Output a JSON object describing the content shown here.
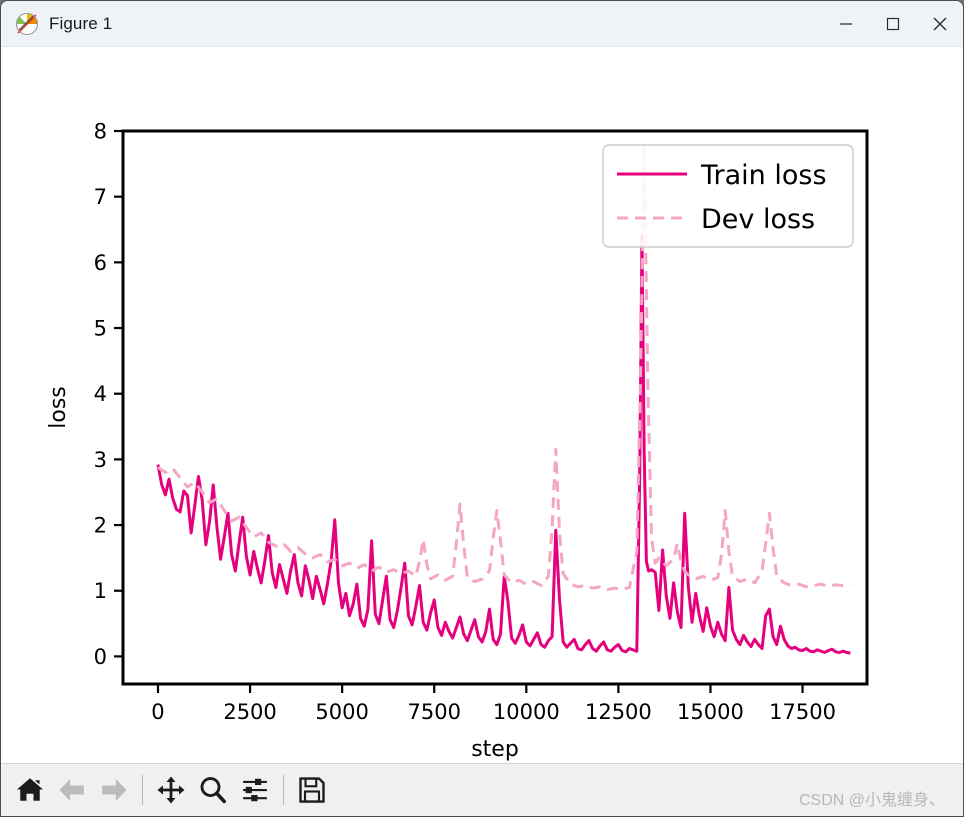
{
  "window": {
    "title": "Figure 1",
    "icon": "matplotlib-icon",
    "minimize_label": "–",
    "maximize_label": "□",
    "close_label": "✕"
  },
  "toolbar": {
    "items": [
      {
        "name": "home-button",
        "icon": "home-icon",
        "enabled": true
      },
      {
        "name": "back-button",
        "icon": "arrow-left-icon",
        "enabled": false
      },
      {
        "name": "forward-button",
        "icon": "arrow-right-icon",
        "enabled": false
      },
      {
        "name": "pan-button",
        "icon": "move-icon",
        "enabled": true
      },
      {
        "name": "zoom-button",
        "icon": "magnifier-icon",
        "enabled": true
      },
      {
        "name": "configure-subplots-button",
        "icon": "sliders-icon",
        "enabled": true
      },
      {
        "name": "save-button",
        "icon": "floppy-disk-icon",
        "enabled": true
      }
    ],
    "watermark": "CSDN @小鬼缠身、"
  },
  "chart_data": {
    "type": "line",
    "title": "",
    "xlabel": "step",
    "ylabel": "loss",
    "xlim": [
      -950,
      19250
    ],
    "ylim": [
      -0.42,
      8.0
    ],
    "xticks": [
      0,
      2500,
      5000,
      7500,
      10000,
      12500,
      15000,
      17500
    ],
    "xtick_labels": [
      "0",
      "2500",
      "5000",
      "7500",
      "10000",
      "12500",
      "15000",
      "17500"
    ],
    "yticks": [
      0,
      1,
      2,
      3,
      4,
      5,
      6,
      7,
      8
    ],
    "ytick_labels": [
      "0",
      "1",
      "2",
      "3",
      "4",
      "5",
      "6",
      "7",
      "8"
    ],
    "grid": false,
    "legend": {
      "position": "upper right",
      "frame": true
    },
    "colors": {
      "train": "#E5007E",
      "dev": "#F4A6C4",
      "axis": "#000000"
    },
    "series": [
      {
        "name": "Train loss",
        "label": "Train loss",
        "color": "#E5007E",
        "style": "solid",
        "width": 3.0,
        "x": [
          0,
          100,
          200,
          300,
          400,
          500,
          600,
          700,
          800,
          900,
          1000,
          1100,
          1200,
          1300,
          1400,
          1500,
          1600,
          1700,
          1800,
          1900,
          2000,
          2100,
          2200,
          2300,
          2400,
          2500,
          2600,
          2700,
          2800,
          2900,
          3000,
          3100,
          3200,
          3300,
          3400,
          3500,
          3600,
          3700,
          3800,
          3900,
          4000,
          4100,
          4200,
          4300,
          4400,
          4500,
          4600,
          4700,
          4800,
          4900,
          5000,
          5100,
          5200,
          5300,
          5400,
          5500,
          5600,
          5700,
          5800,
          5900,
          6000,
          6100,
          6200,
          6300,
          6400,
          6500,
          6600,
          6700,
          6800,
          6900,
          7000,
          7100,
          7200,
          7300,
          7400,
          7500,
          7600,
          7700,
          7800,
          7900,
          8000,
          8100,
          8200,
          8300,
          8400,
          8500,
          8600,
          8700,
          8800,
          8900,
          9000,
          9100,
          9200,
          9300,
          9400,
          9500,
          9600,
          9700,
          9800,
          9900,
          10000,
          10100,
          10200,
          10300,
          10400,
          10500,
          10600,
          10700,
          10800,
          10900,
          11000,
          11100,
          11200,
          11300,
          11400,
          11500,
          11600,
          11700,
          11800,
          11900,
          12000,
          12100,
          12200,
          12300,
          12400,
          12500,
          12600,
          12700,
          12800,
          12900,
          13000,
          13080,
          13140,
          13200,
          13260,
          13320,
          13400,
          13500,
          13600,
          13700,
          13800,
          13900,
          14000,
          14100,
          14200,
          14300,
          14400,
          14500,
          14600,
          14700,
          14800,
          14900,
          15000,
          15100,
          15200,
          15300,
          15400,
          15500,
          15600,
          15700,
          15800,
          15900,
          16000,
          16100,
          16200,
          16300,
          16400,
          16500,
          16600,
          16700,
          16800,
          16900,
          17000,
          17100,
          17200,
          17300,
          17400,
          17500,
          17600,
          17700,
          17800,
          17900,
          18000,
          18100,
          18200,
          18300,
          18400,
          18500,
          18600,
          18700,
          18800
        ],
        "y": [
          2.92,
          2.62,
          2.46,
          2.7,
          2.41,
          2.24,
          2.2,
          2.52,
          2.45,
          1.88,
          2.3,
          2.74,
          2.38,
          1.7,
          2.05,
          2.61,
          1.97,
          1.48,
          1.82,
          2.18,
          1.55,
          1.3,
          1.72,
          2.12,
          1.52,
          1.24,
          1.6,
          1.34,
          1.12,
          1.45,
          1.84,
          1.28,
          1.05,
          1.4,
          1.18,
          0.96,
          1.3,
          1.55,
          1.12,
          0.92,
          1.38,
          1.16,
          0.88,
          1.22,
          1.02,
          0.8,
          1.1,
          1.45,
          2.08,
          1.12,
          0.74,
          0.96,
          0.62,
          0.8,
          1.1,
          0.58,
          0.46,
          0.72,
          1.76,
          0.64,
          0.5,
          0.86,
          1.22,
          0.56,
          0.44,
          0.7,
          1.05,
          1.42,
          0.62,
          0.48,
          0.76,
          1.08,
          0.52,
          0.4,
          0.66,
          0.86,
          0.44,
          0.32,
          0.52,
          0.38,
          0.28,
          0.44,
          0.6,
          0.34,
          0.24,
          0.4,
          0.56,
          0.3,
          0.22,
          0.38,
          0.72,
          0.26,
          0.18,
          0.34,
          1.22,
          0.84,
          0.28,
          0.2,
          0.32,
          0.48,
          0.22,
          0.16,
          0.26,
          0.36,
          0.18,
          0.14,
          0.24,
          0.3,
          1.92,
          0.88,
          0.22,
          0.14,
          0.2,
          0.26,
          0.12,
          0.1,
          0.18,
          0.24,
          0.12,
          0.08,
          0.16,
          0.22,
          0.1,
          0.08,
          0.14,
          0.18,
          0.09,
          0.07,
          0.12,
          0.1,
          0.08,
          2.8,
          6.4,
          3.1,
          1.45,
          1.3,
          1.32,
          1.28,
          0.7,
          1.62,
          0.92,
          0.58,
          1.12,
          0.68,
          0.44,
          2.18,
          1.05,
          0.52,
          0.96,
          0.62,
          0.38,
          0.74,
          0.46,
          0.3,
          0.52,
          0.34,
          0.24,
          1.05,
          0.4,
          0.26,
          0.18,
          0.32,
          0.22,
          0.15,
          0.26,
          0.18,
          0.12,
          0.62,
          0.72,
          0.3,
          0.18,
          0.46,
          0.26,
          0.16,
          0.12,
          0.14,
          0.1,
          0.09,
          0.12,
          0.08,
          0.07,
          0.1,
          0.08,
          0.06,
          0.09,
          0.11,
          0.07,
          0.06,
          0.08,
          0.06,
          0.05,
          0.07,
          0.06,
          0.05
        ]
      },
      {
        "name": "Dev loss",
        "label": "Dev loss",
        "color": "#F4A6C4",
        "style": "dashed",
        "width": 3.0,
        "x": [
          0,
          200,
          400,
          600,
          800,
          1000,
          1200,
          1400,
          1600,
          1800,
          2000,
          2200,
          2400,
          2600,
          2800,
          3000,
          3200,
          3400,
          3600,
          3800,
          4000,
          4200,
          4400,
          4600,
          4800,
          5000,
          5200,
          5400,
          5600,
          5800,
          6000,
          6200,
          6400,
          6600,
          6800,
          7000,
          7100,
          7200,
          7300,
          7400,
          7600,
          7800,
          8000,
          8100,
          8200,
          8300,
          8400,
          8600,
          8800,
          9000,
          9100,
          9200,
          9300,
          9400,
          9600,
          9800,
          10000,
          10200,
          10400,
          10600,
          10700,
          10800,
          10900,
          11000,
          11200,
          11400,
          11600,
          11800,
          12000,
          12200,
          12400,
          12600,
          12800,
          13000,
          13100,
          13200,
          13300,
          13400,
          13500,
          13600,
          13800,
          14000,
          14100,
          14200,
          14300,
          14400,
          14600,
          14800,
          15000,
          15200,
          15300,
          15400,
          15500,
          15600,
          15800,
          16000,
          16200,
          16400,
          16500,
          16600,
          16700,
          16800,
          17000,
          17200,
          17400,
          17600,
          17800,
          18000,
          18200,
          18400,
          18600,
          18800
        ],
        "y": [
          2.88,
          2.8,
          2.86,
          2.72,
          2.58,
          2.65,
          2.5,
          2.34,
          2.4,
          2.22,
          2.06,
          2.12,
          1.96,
          1.82,
          1.88,
          1.74,
          1.68,
          1.72,
          1.6,
          1.66,
          1.56,
          1.5,
          1.55,
          1.44,
          1.48,
          1.38,
          1.42,
          1.34,
          1.4,
          1.3,
          1.36,
          1.28,
          1.32,
          1.26,
          1.3,
          1.22,
          1.45,
          1.78,
          1.4,
          1.18,
          1.24,
          1.16,
          1.22,
          1.72,
          2.32,
          1.7,
          1.2,
          1.14,
          1.18,
          1.3,
          1.8,
          2.22,
          1.76,
          1.24,
          1.12,
          1.16,
          1.1,
          1.14,
          1.08,
          1.22,
          1.95,
          3.15,
          1.9,
          1.26,
          1.1,
          1.06,
          1.08,
          1.04,
          1.06,
          1.02,
          1.04,
          1.02,
          1.05,
          1.6,
          4.2,
          7.8,
          4.1,
          1.8,
          1.42,
          1.5,
          1.38,
          1.48,
          1.72,
          1.44,
          1.3,
          1.24,
          1.18,
          1.22,
          1.16,
          1.2,
          1.55,
          2.22,
          1.6,
          1.22,
          1.14,
          1.18,
          1.12,
          1.3,
          1.72,
          2.18,
          1.64,
          1.22,
          1.12,
          1.08,
          1.1,
          1.06,
          1.08,
          1.1,
          1.07,
          1.09,
          1.08,
          1.1
        ]
      }
    ]
  }
}
